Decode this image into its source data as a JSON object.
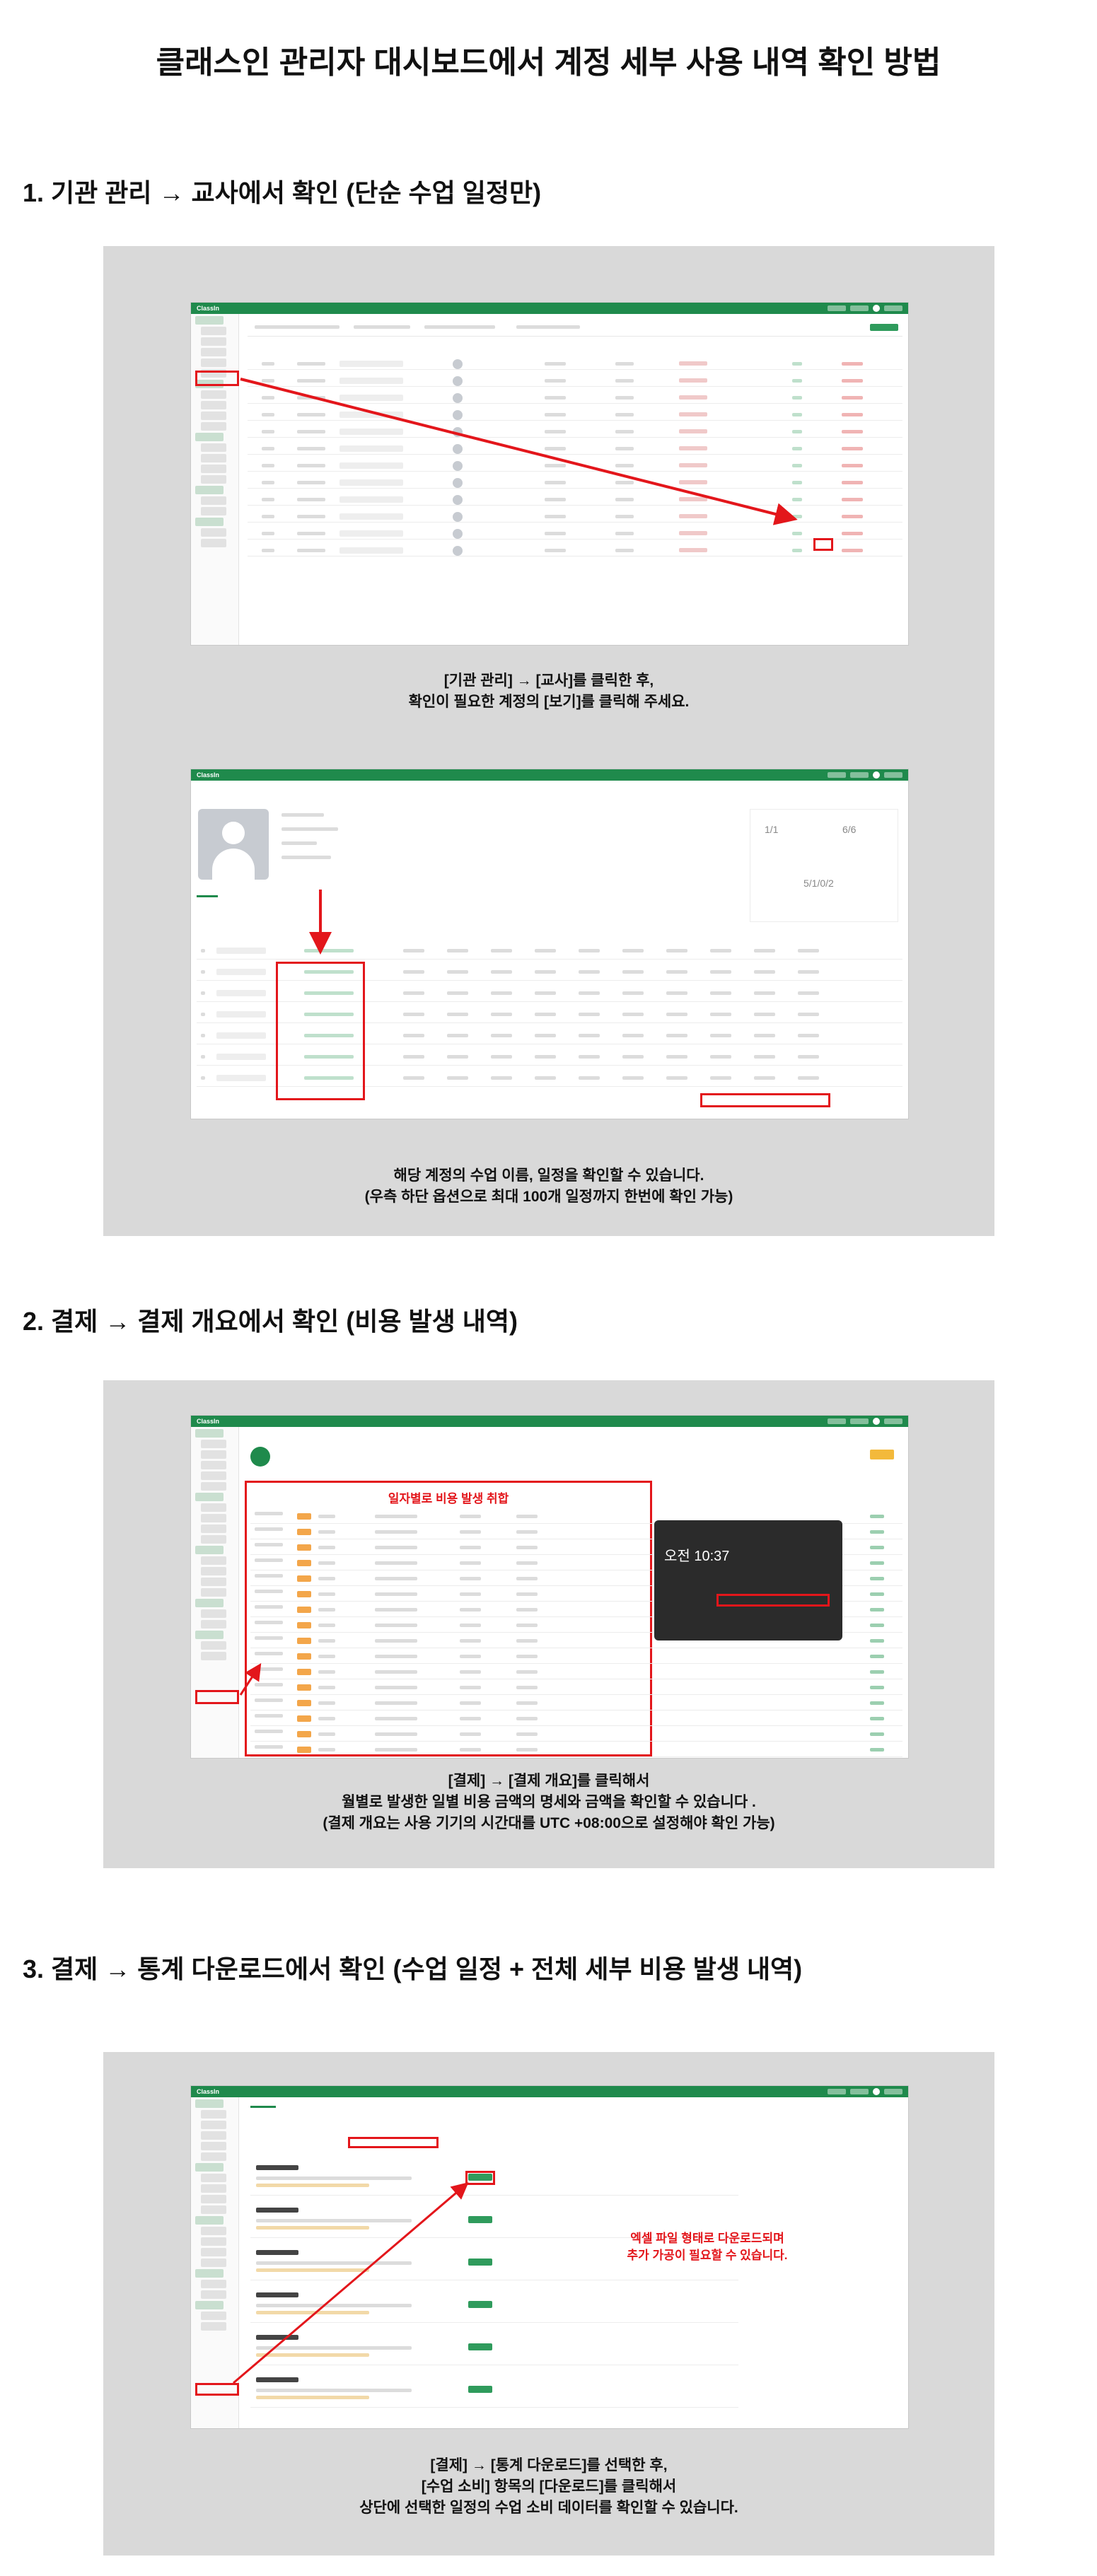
{
  "title": "클래스인 관리자 대시보드에서 계정 세부 사용 내역 확인 방법",
  "sections": [
    {
      "heading": "1. 기관 관리 → 교사에서 확인 (단순 수업 일정만)",
      "shots": [
        {
          "app_name": "ClassIn",
          "caption": [
            "[기관 관리] → [교사]를 클릭한 후,",
            "확인이 필요한 계정의 [보기]를 클릭해 주세요."
          ]
        },
        {
          "app_name": "ClassIn",
          "stats": [
            "1/1",
            "6/6",
            "5/1/0/2"
          ],
          "caption": [
            "해당 계정의 수업 이름, 일정을 확인할 수 있습니다.",
            "(우측 하단 옵션으로 최대 100개 일정까지 한번에 확인 가능)"
          ]
        }
      ]
    },
    {
      "heading": "2. 결제 → 결제 개요에서 확인 (비용 발생 내역)",
      "shots": [
        {
          "app_name": "ClassIn",
          "annotation": "일자별로 비용 발생 취합",
          "phone_time": "오전 10:37",
          "caption": [
            "[결제] → [결제 개요]를 클릭해서",
            "월별로 발생한 일별 비용 금액의 명세와 금액을 확인할 수 있습니다 .",
            "(결제 개요는 사용 기기의 시간대를 UTC +08:00으로 설정해야 확인 가능)"
          ]
        }
      ]
    },
    {
      "heading": "3. 결제 → 통계 다운로드에서 확인 (수업 일정 + 전체 세부 비용 발생 내역)",
      "shots": [
        {
          "app_name": "ClassIn",
          "annotation": [
            "엑셀 파일 형태로 다운로드되며",
            "추가 가공이 필요할 수 있습니다."
          ],
          "caption": [
            "[결제] → [통계 다운로드]를 선택한 후,",
            "[수업 소비] 항목의 [다운로드]를 클릭해서",
            "상단에 선택한 일정의 수업 소비 데이터를 확인할 수 있습니다."
          ]
        }
      ]
    }
  ],
  "colors": {
    "accent_green": "#1f8a4c",
    "highlight_red": "#e3161b",
    "panel_gray": "#d9d9d9"
  }
}
